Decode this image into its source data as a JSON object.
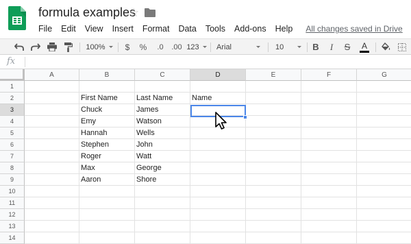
{
  "document": {
    "title": "formula examples",
    "save_status": "All changes saved in Drive"
  },
  "menu": [
    "File",
    "Edit",
    "View",
    "Insert",
    "Format",
    "Data",
    "Tools",
    "Add-ons",
    "Help"
  ],
  "toolbar": {
    "zoom": "100%",
    "currency": "$",
    "percent": "%",
    "decrease_decimal": ".0",
    "increase_decimal": ".00",
    "more_formats": "123",
    "font": "Arial",
    "font_size": "10",
    "bold": "B",
    "italic": "I",
    "strikethrough": "S",
    "text_color": "A",
    "text_color_value": "#000000"
  },
  "formula_bar": {
    "icon": "fx",
    "value": ""
  },
  "grid": {
    "columns": [
      "A",
      "B",
      "C",
      "D",
      "E",
      "F",
      "G"
    ],
    "active_column": "D",
    "rows": [
      "1",
      "2",
      "3",
      "4",
      "5",
      "6",
      "7",
      "8",
      "9",
      "10",
      "11",
      "12",
      "13",
      "14"
    ],
    "active_row": "3",
    "cells": [
      [
        "",
        "",
        "",
        "",
        "",
        "",
        ""
      ],
      [
        "",
        "First Name",
        "Last Name",
        "Name",
        "",
        "",
        ""
      ],
      [
        "",
        "Chuck",
        "James",
        "",
        "",
        "",
        ""
      ],
      [
        "",
        "Emy",
        "Watson",
        "",
        "",
        "",
        ""
      ],
      [
        "",
        "Hannah",
        "Wells",
        "",
        "",
        "",
        ""
      ],
      [
        "",
        "Stephen",
        "John",
        "",
        "",
        "",
        ""
      ],
      [
        "",
        "Roger",
        "Watt",
        "",
        "",
        "",
        ""
      ],
      [
        "",
        "Max",
        "George",
        "",
        "",
        "",
        ""
      ],
      [
        "",
        "Aaron",
        "Shore",
        "",
        "",
        "",
        ""
      ],
      [
        "",
        "",
        "",
        "",
        "",
        "",
        ""
      ],
      [
        "",
        "",
        "",
        "",
        "",
        "",
        ""
      ],
      [
        "",
        "",
        "",
        "",
        "",
        "",
        ""
      ],
      [
        "",
        "",
        "",
        "",
        "",
        "",
        ""
      ],
      [
        "",
        "",
        "",
        "",
        "",
        "",
        ""
      ]
    ],
    "selected_cell": "D3"
  },
  "colors": {
    "brand": "#0f9d58",
    "selection": "#4a86e8"
  }
}
